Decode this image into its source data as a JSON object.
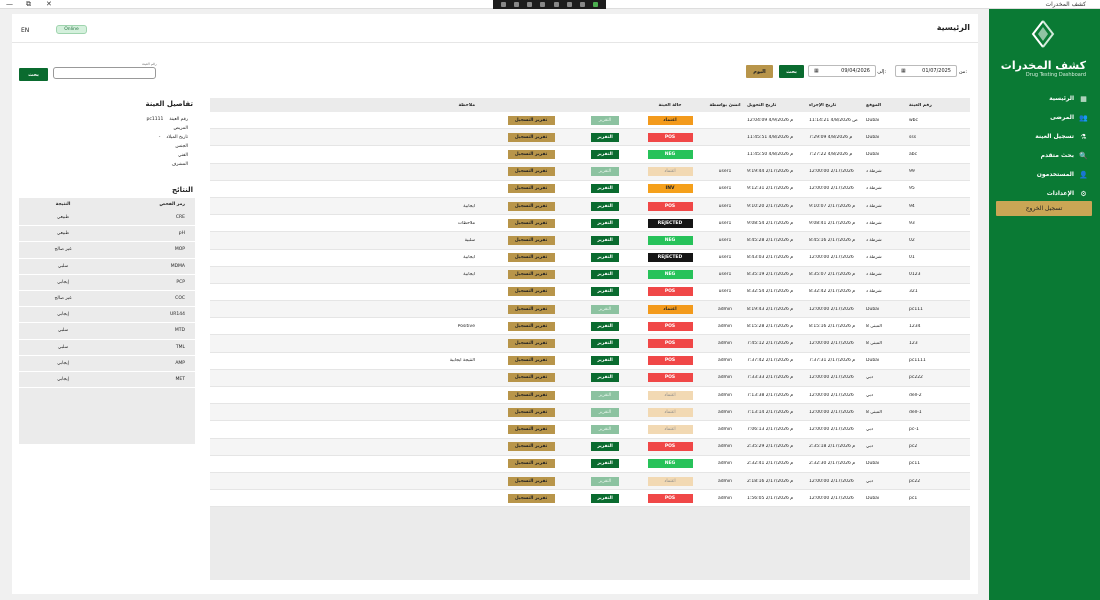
{
  "window": {
    "title": "كشف المخدرات",
    "controls": [
      "—",
      "⧉",
      "✕"
    ]
  },
  "sidebar": {
    "brand": "كشف المخدرات",
    "brand_sub": "Drug Testing Dashboard",
    "items": [
      {
        "label": "الرئيسية",
        "icon": "dashboard-icon",
        "glyph": "▦"
      },
      {
        "label": "المرضى",
        "icon": "patients-icon",
        "glyph": "👥"
      },
      {
        "label": "تسجيل العينة",
        "icon": "flask-icon",
        "glyph": "⚗"
      },
      {
        "label": "بحث متقدم",
        "icon": "search-icon",
        "glyph": "🔍"
      },
      {
        "label": "المستخدمون",
        "icon": "users-icon",
        "glyph": "👤"
      },
      {
        "label": "الإعدادات",
        "icon": "gear-icon",
        "glyph": "⚙"
      }
    ],
    "logout": "تسجيل الخروج"
  },
  "header": {
    "title": "الرئيسية",
    "lang": "EN",
    "status": "Online"
  },
  "filters": {
    "from_label": "من:",
    "from_date": "01/07/2025",
    "to_label": "إلى:",
    "to_date": "09/04/2026",
    "search": "بحث",
    "today": "اليوم",
    "sample_label": "رقم العينة",
    "sample_value": "",
    "search2": "بحث"
  },
  "details": {
    "title": "تفاصيل العينة",
    "rows": [
      {
        "label": "رقم العينة",
        "value": "pc1111"
      },
      {
        "label": "المريض",
        "value": ""
      },
      {
        "label": "تاريخ الميلاد",
        "value": "-"
      },
      {
        "label": "الجنس",
        "value": ""
      },
      {
        "label": "الفني",
        "value": ""
      },
      {
        "label": "المشرف",
        "value": ""
      }
    ]
  },
  "results": {
    "title": "النتائج",
    "headers": {
      "code": "رمز الفحص",
      "result": "النتيجة"
    },
    "rows": [
      {
        "code": "CRE",
        "result": "طبيعي"
      },
      {
        "code": "pH",
        "result": "طبيعي"
      },
      {
        "code": "MOP",
        "result": "غير صالح"
      },
      {
        "code": "MDMA",
        "result": "سلبي"
      },
      {
        "code": "PCP",
        "result": "إيجابي"
      },
      {
        "code": "COC",
        "result": "غير صالح"
      },
      {
        "code": "UR144",
        "result": "إيجابي"
      },
      {
        "code": "MTD",
        "result": "سلبي"
      },
      {
        "code": "TML",
        "result": "سلبي"
      },
      {
        "code": "AMP",
        "result": "إيجابي"
      },
      {
        "code": "MET",
        "result": "إيجابي"
      }
    ]
  },
  "table": {
    "headers": {
      "id": "رقم العينة",
      "loc": "الموقع",
      "proc": "تاريخ الإجراء",
      "trans": "تاريخ التحويل",
      "by": "أنشئ بواسطة",
      "state": "حالة العينة",
      "note": "ملاحظة"
    },
    "report_label": "التقرير",
    "register_label": "تقرير التسجيل",
    "rows": [
      {
        "id": "wbc",
        "loc": "Dubai",
        "proc": "11:14:21 4/8/2026 ص",
        "trans": "12:04:09 4/9/2026 م",
        "by": "",
        "state": "اعتماد",
        "cls": "b-approve",
        "rep_faded": true,
        "note": ""
      },
      {
        "id": "sss",
        "loc": "Dubai",
        "proc": "7:29:09 4/8/2026 م",
        "trans": "11:45:51 4/8/2026 م",
        "by": "",
        "state": "POS",
        "cls": "b-pos",
        "rep_faded": false,
        "note": ""
      },
      {
        "id": "abc",
        "loc": "Dubai",
        "proc": "7:27:22 4/8/2026 م",
        "trans": "11:45:50 4/8/2026 م",
        "by": "",
        "state": "NEG",
        "cls": "b-neg",
        "rep_faded": false,
        "note": ""
      },
      {
        "id": "99",
        "loc": "شرطة د",
        "proc": "12:00:00 2/17/2026",
        "trans": "9:19:44 2/17/2026 م",
        "by": "user1",
        "state": "اعتماد",
        "cls": "b-approve-f",
        "rep_faded": true,
        "note": ""
      },
      {
        "id": "95",
        "loc": "شرطة د",
        "proc": "12:00:00 2/17/2026",
        "trans": "9:12:31 2/17/2026 م",
        "by": "user1",
        "state": "INV",
        "cls": "b-inv",
        "rep_faded": false,
        "note": ""
      },
      {
        "id": "94",
        "loc": "شرطة د",
        "proc": "9:10:07 2/17/2026 م",
        "trans": "9:10:20 2/17/2026 م",
        "by": "user1",
        "state": "POS",
        "cls": "b-pos",
        "rep_faded": false,
        "note": "ايجابية"
      },
      {
        "id": "93",
        "loc": "شرطة د",
        "proc": "9:08:41 2/17/2026 م",
        "trans": "9:08:54 2/17/2026 م",
        "by": "user1",
        "state": "REJECTED",
        "cls": "b-rej",
        "rep_faded": false,
        "note": "ملاحظات"
      },
      {
        "id": "02",
        "loc": "شرطة د",
        "proc": "8:45:16 2/17/2026 م",
        "trans": "8:45:28 2/17/2026 م",
        "by": "user1",
        "state": "NEG",
        "cls": "b-neg",
        "rep_faded": false,
        "note": "سلبية"
      },
      {
        "id": "01",
        "loc": "شرطة د",
        "proc": "12:00:00 2/17/2026",
        "trans": "8:43:03 2/17/2026 م",
        "by": "user1",
        "state": "REJECTED",
        "cls": "b-rej",
        "rep_faded": false,
        "note": "ايجابية"
      },
      {
        "id": "0123",
        "loc": "شرطة د",
        "proc": "8:35:07 2/17/2026 م",
        "trans": "8:35:19 2/17/2026 م",
        "by": "user1",
        "state": "NEG",
        "cls": "b-neg",
        "rep_faded": false,
        "note": "ايجابية"
      },
      {
        "id": "321",
        "loc": "شرطة د",
        "proc": "8:32:42 2/17/2026 م",
        "trans": "8:32:54 2/17/2026 م",
        "by": "user1",
        "state": "POS",
        "cls": "b-pos",
        "rep_faded": false,
        "note": ""
      },
      {
        "id": "pc111",
        "loc": "Dubai",
        "proc": "12:00:00 2/17/2026",
        "trans": "8:19:43 2/17/2026 م",
        "by": "admin",
        "state": "اعتماد",
        "cls": "b-approve",
        "rep_faded": true,
        "note": ""
      },
      {
        "id": "1234",
        "loc": "المبنى 8",
        "proc": "8:15:16 2/17/2026 م",
        "trans": "8:15:28 2/17/2026 م",
        "by": "admin",
        "state": "POS",
        "cls": "b-pos",
        "rep_faded": false,
        "note": "Positive"
      },
      {
        "id": "123",
        "loc": "المبنى 8",
        "proc": "12:00:00 2/17/2026",
        "trans": "7:45:12 2/17/2026 م",
        "by": "admin",
        "state": "POS",
        "cls": "b-pos",
        "rep_faded": false,
        "note": ""
      },
      {
        "id": "pc1111",
        "loc": "Dubai",
        "proc": "7:37:31 2/17/2026 م",
        "trans": "7:37:42 2/17/2026 م",
        "by": "admin",
        "state": "POS",
        "cls": "b-pos",
        "rep_faded": false,
        "note": "النتيجة ايجابية"
      },
      {
        "id": "pc222",
        "loc": "دبي",
        "proc": "12:00:00 2/17/2026",
        "trans": "7:33:33 2/17/2026 م",
        "by": "admin",
        "state": "POS",
        "cls": "b-pos",
        "rep_faded": false,
        "note": ""
      },
      {
        "id": "dell-2",
        "loc": "دبي",
        "proc": "12:00:00 2/17/2026",
        "trans": "7:13:38 2/17/2026 م",
        "by": "admin",
        "state": "اعتماد",
        "cls": "b-approve-f",
        "rep_faded": true,
        "note": ""
      },
      {
        "id": "dell-1",
        "loc": "المبنى 8",
        "proc": "12:00:00 2/17/2026",
        "trans": "7:13:14 2/17/2026 م",
        "by": "admin",
        "state": "اعتماد",
        "cls": "b-approve-f",
        "rep_faded": true,
        "note": ""
      },
      {
        "id": "pc-1",
        "loc": "دبي",
        "proc": "12:00:00 2/17/2026",
        "trans": "7:06:13 2/17/2026 م",
        "by": "admin",
        "state": "اعتماد",
        "cls": "b-approve-f",
        "rep_faded": true,
        "note": ""
      },
      {
        "id": "pc2",
        "loc": "دبي",
        "proc": "2:35:18 2/17/2026 م",
        "trans": "2:35:29 2/17/2026 م",
        "by": "admin",
        "state": "POS",
        "cls": "b-pos",
        "rep_faded": false,
        "note": ""
      },
      {
        "id": "pc11",
        "loc": "Dubai",
        "proc": "2:32:30 2/17/2026 م",
        "trans": "2:32:41 2/17/2026 م",
        "by": "admin",
        "state": "NEG",
        "cls": "b-neg",
        "rep_faded": false,
        "note": ""
      },
      {
        "id": "pc22",
        "loc": "دبي",
        "proc": "12:00:00 2/17/2026",
        "trans": "2:18:16 2/17/2026 م",
        "by": "admin",
        "state": "اعتماد",
        "cls": "b-approve-f",
        "rep_faded": true,
        "note": ""
      },
      {
        "id": "pc1",
        "loc": "Dubai",
        "proc": "12:00:00 2/17/2026",
        "trans": "1:56:05 2/17/2026 م",
        "by": "admin",
        "state": "POS",
        "cls": "b-pos",
        "rep_faded": false,
        "note": ""
      }
    ]
  }
}
